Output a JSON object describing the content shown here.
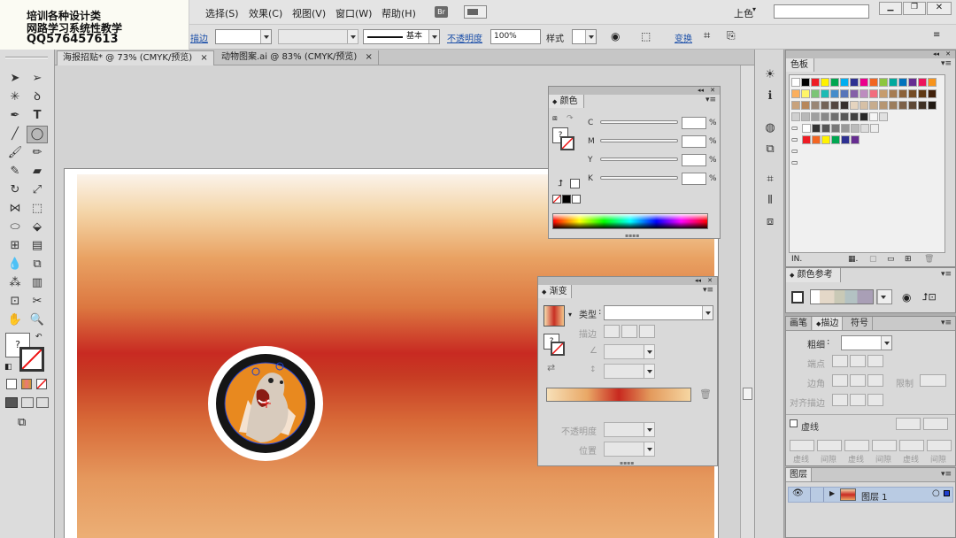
{
  "watermark": {
    "line1": "培训各种设计类",
    "line2": "网路学习系统性教学",
    "line3": "QQ576457613"
  },
  "menubar": {
    "menus": [
      "选择(S)",
      "效果(C)",
      "视图(V)",
      "窗口(W)",
      "帮助(H)"
    ],
    "br_label": "Br",
    "workspace": "上色"
  },
  "controlbar": {
    "stroke_label": "描边",
    "stroke_style": "基本",
    "opacity_label": "不透明度",
    "opacity_value": "100%",
    "style_label": "样式",
    "transform_label": "变换"
  },
  "tabs": [
    {
      "label": "海报招贴* @ 73% (CMYK/预览)",
      "close": "×"
    },
    {
      "label": "动物图案.ai @ 83% (CMYK/预览)",
      "close": "×"
    }
  ],
  "toolbox": {
    "fill_stroke_q": "?"
  },
  "color_panel": {
    "title": "颜色",
    "channels": [
      "C",
      "M",
      "Y",
      "K"
    ],
    "percent": "%",
    "q": "?"
  },
  "gradient_panel": {
    "title": "渐变",
    "type_label": "类型",
    "stroke_label": "描边",
    "opacity_label": "不透明度",
    "position_label": "位置",
    "q": "?"
  },
  "swatches_panel": {
    "title": "色板"
  },
  "color_guide_panel": {
    "title": "颜色参考"
  },
  "stroke_panel": {
    "tabs": [
      "画笔",
      "描边",
      "符号"
    ],
    "weight_label": "粗细",
    "cap_label": "端点",
    "corner_label": "边角",
    "limit_label": "限制",
    "align_label": "对齐描边",
    "dashed_label": "虚线",
    "dash_labels": [
      "虚线",
      "间隙",
      "虚线",
      "间隙",
      "虚线",
      "间隙"
    ]
  },
  "layers_panel": {
    "title": "图层",
    "layer_name": "图层 1"
  },
  "colors": {
    "spectrum": [
      "#ff0000",
      "#ffff00",
      "#00ff00",
      "#00ffff",
      "#0000ff",
      "#ff00ff",
      "#ff0000"
    ],
    "swatch_row1": [
      "#ffffff",
      "#000000",
      "#ee1c24",
      "#fff200",
      "#00a651",
      "#00aeef",
      "#2e3192",
      "#ec008c",
      "#f26522",
      "#8dc63f",
      "#00a99d",
      "#0072bc",
      "#662d91",
      "#ed145b",
      "#f7941d"
    ],
    "swatch_row2": [
      "#fbaf5d",
      "#fff568",
      "#7cc576",
      "#1cbbb4",
      "#448ccb",
      "#5674b9",
      "#8560a8",
      "#bd8cbf",
      "#f26d7d",
      "#c69c6d",
      "#a67c52",
      "#8c6239",
      "#754c24",
      "#603913",
      "#42210b"
    ],
    "swatch_row3": [
      "#c8a27c",
      "#b7875b",
      "#998675",
      "#736357",
      "#534741",
      "#362f2d",
      "#e5d4bf",
      "#d6c0a6",
      "#c7ac8d",
      "#b69672",
      "#9b7d5d",
      "#7d6148",
      "#5e4936",
      "#3f3124",
      "#211a13"
    ]
  }
}
